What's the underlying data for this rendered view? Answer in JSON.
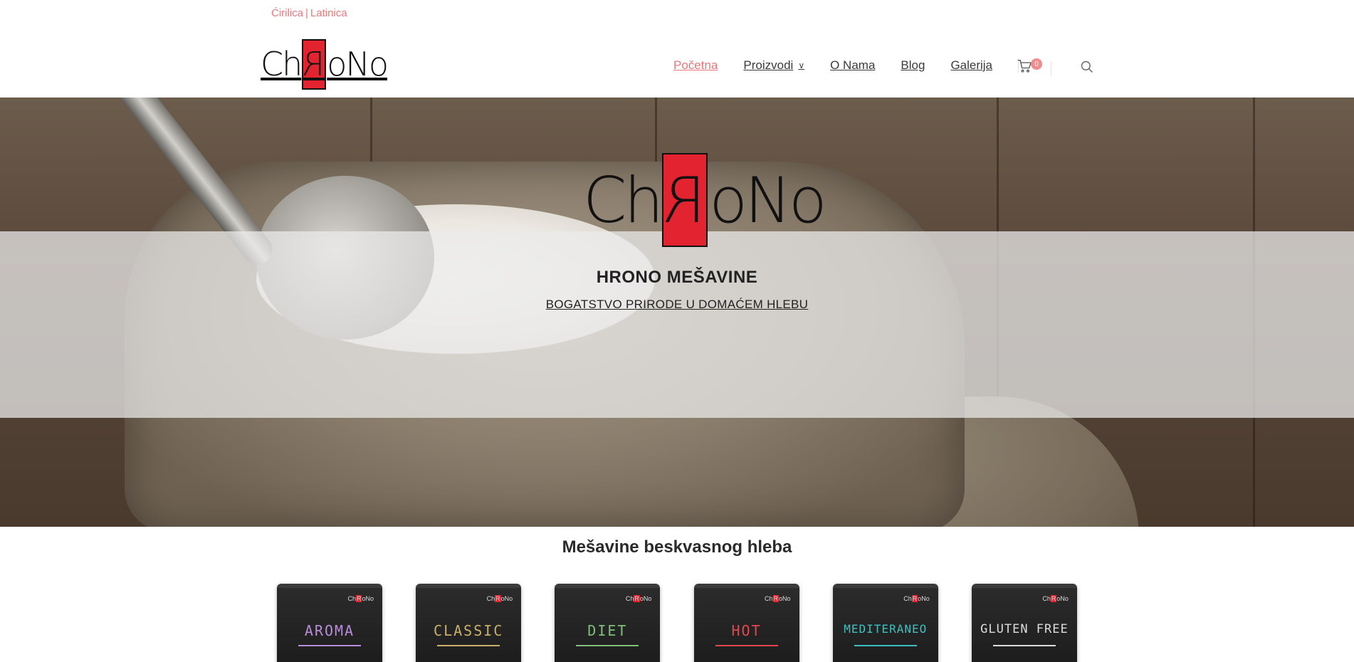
{
  "topbar": {
    "lang_cyrillic": "Ćirilica",
    "separator": "|",
    "lang_latin": "Latinica"
  },
  "logo": {
    "part1": "Ch",
    "part2": "R",
    "part3": "oNo"
  },
  "nav": {
    "items": [
      {
        "label": "Početna",
        "active": true
      },
      {
        "label": "Proizvodi",
        "has_dropdown": true
      },
      {
        "label": "O Nama"
      },
      {
        "label": "Blog"
      },
      {
        "label": "Galerija"
      }
    ],
    "cart_count": "0",
    "cart_icon": "cart-icon",
    "search_icon": "search-icon"
  },
  "hero": {
    "title": "HRONO MEŠAVINE",
    "subtitle": "BOGATSTVO PRIRODE U DOMAĆEM HLEBU"
  },
  "products_section": {
    "title": "Mešavine beskvasnog hleba",
    "items": [
      {
        "name": "AROMA",
        "color": "#b78cd8"
      },
      {
        "name": "CLASSIC",
        "color": "#c9b06a"
      },
      {
        "name": "DIET",
        "color": "#7fbf7a"
      },
      {
        "name": "HOT",
        "color": "#e0474f"
      },
      {
        "name": "MEDITERANEO",
        "color": "#3fc0c0"
      },
      {
        "name": "GLUTEN FREE",
        "color": "#dcdcdc"
      }
    ]
  },
  "colors": {
    "accent": "#e7777a",
    "logo_red": "#e42331",
    "badge": "#f28b8e"
  }
}
